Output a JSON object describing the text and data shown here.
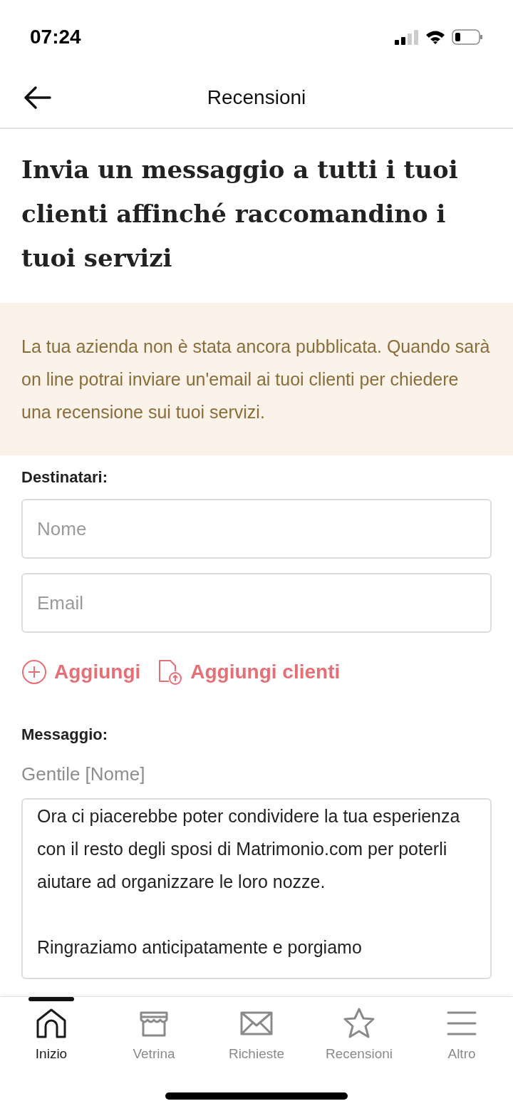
{
  "status_bar": {
    "time": "07:24"
  },
  "header": {
    "title": "Recensioni"
  },
  "heading": "Invia un messaggio a tutti i tuoi clienti affinché raccomandino i tuoi servizi",
  "notice": "La tua azienda non è stata ancora pubblicata. Quando sarà on line potrai inviare un'email ai tuoi clienti per chiedere una recensione sui tuoi servizi.",
  "recipients": {
    "label": "Destinatari:",
    "fields": [
      {
        "placeholder": "Nome"
      },
      {
        "placeholder": "Email"
      }
    ]
  },
  "actions": [
    {
      "kind": "add",
      "label": "Aggiungi"
    },
    {
      "kind": "upload",
      "label": "Aggiungi clienti"
    }
  ],
  "message": {
    "label": "Messaggio:",
    "greeting": "Gentile [Nome]",
    "paragraphs": [
      "Ora ci piacerebbe poter condividere la tua esperienza con il resto degli sposi di Matrimonio.com per poterli aiutare ad organizzare le loro nozze.",
      "Ringraziamo anticipatamente e porgiamo"
    ]
  },
  "tabs": [
    {
      "kind": "home",
      "label": "Inizio",
      "selected": true
    },
    {
      "kind": "shop",
      "label": "Vetrina",
      "selected": false
    },
    {
      "kind": "mail",
      "label": "Richieste",
      "selected": false
    },
    {
      "kind": "star",
      "label": "Recensioni",
      "selected": false
    },
    {
      "kind": "menu",
      "label": "Altro",
      "selected": false
    }
  ]
}
